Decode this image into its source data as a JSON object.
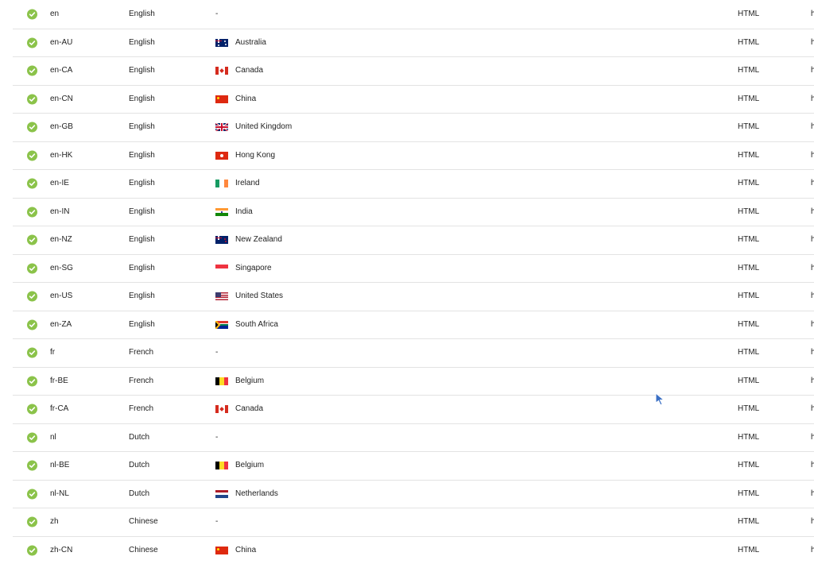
{
  "rows": [
    {
      "code": "en",
      "language": "English",
      "region": "-",
      "flag": "",
      "format": "HTML",
      "extra": "h"
    },
    {
      "code": "en-AU",
      "language": "English",
      "region": "Australia",
      "flag": "au-flag",
      "format": "HTML",
      "extra": "h"
    },
    {
      "code": "en-CA",
      "language": "English",
      "region": "Canada",
      "flag": "ca-flag",
      "format": "HTML",
      "extra": "h"
    },
    {
      "code": "en-CN",
      "language": "English",
      "region": "China",
      "flag": "cn-flag",
      "format": "HTML",
      "extra": "h"
    },
    {
      "code": "en-GB",
      "language": "English",
      "region": "United Kingdom",
      "flag": "gb-flag",
      "format": "HTML",
      "extra": "h"
    },
    {
      "code": "en-HK",
      "language": "English",
      "region": "Hong Kong",
      "flag": "hk-flag",
      "format": "HTML",
      "extra": "h"
    },
    {
      "code": "en-IE",
      "language": "English",
      "region": "Ireland",
      "flag": "ie-flag",
      "format": "HTML",
      "extra": "h"
    },
    {
      "code": "en-IN",
      "language": "English",
      "region": "India",
      "flag": "in-flag",
      "format": "HTML",
      "extra": "h"
    },
    {
      "code": "en-NZ",
      "language": "English",
      "region": "New Zealand",
      "flag": "nz-flag",
      "format": "HTML",
      "extra": "h"
    },
    {
      "code": "en-SG",
      "language": "English",
      "region": "Singapore",
      "flag": "sg-flag",
      "format": "HTML",
      "extra": "h"
    },
    {
      "code": "en-US",
      "language": "English",
      "region": "United States",
      "flag": "us-flag",
      "format": "HTML",
      "extra": "h"
    },
    {
      "code": "en-ZA",
      "language": "English",
      "region": "South Africa",
      "flag": "za-flag",
      "format": "HTML",
      "extra": "h"
    },
    {
      "code": "fr",
      "language": "French",
      "region": "-",
      "flag": "",
      "format": "HTML",
      "extra": "h"
    },
    {
      "code": "fr-BE",
      "language": "French",
      "region": "Belgium",
      "flag": "be-flag",
      "format": "HTML",
      "extra": "h"
    },
    {
      "code": "fr-CA",
      "language": "French",
      "region": "Canada",
      "flag": "ca-flag",
      "format": "HTML",
      "extra": "h"
    },
    {
      "code": "nl",
      "language": "Dutch",
      "region": "-",
      "flag": "",
      "format": "HTML",
      "extra": "h"
    },
    {
      "code": "nl-BE",
      "language": "Dutch",
      "region": "Belgium",
      "flag": "be-flag",
      "format": "HTML",
      "extra": "h"
    },
    {
      "code": "nl-NL",
      "language": "Dutch",
      "region": "Netherlands",
      "flag": "nl-flag",
      "format": "HTML",
      "extra": "h"
    },
    {
      "code": "zh",
      "language": "Chinese",
      "region": "-",
      "flag": "",
      "format": "HTML",
      "extra": "h"
    },
    {
      "code": "zh-CN",
      "language": "Chinese",
      "region": "China",
      "flag": "cn-flag",
      "format": "HTML",
      "extra": "h"
    }
  ],
  "status_icon": "check-circle-icon",
  "colors": {
    "status_ok": "#8bc34a",
    "divider": "#e3e3e3",
    "text": "#222222",
    "cursor": "#3a6fc4"
  }
}
